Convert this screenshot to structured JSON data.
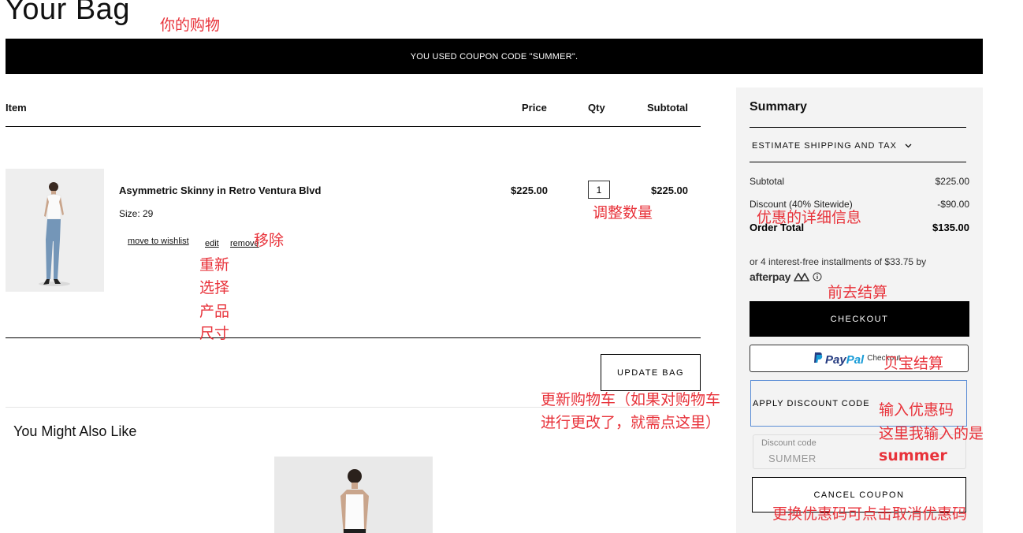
{
  "page": {
    "title": "Your Bag"
  },
  "banner": {
    "text": "YOU USED COUPON CODE \"SUMMER\"."
  },
  "table": {
    "headers": {
      "item": "Item",
      "price": "Price",
      "qty": "Qty",
      "subtotal": "Subtotal"
    }
  },
  "item": {
    "name": "Asymmetric Skinny in Retro Ventura Blvd",
    "size": "Size: 29",
    "price": "$225.00",
    "qty": "1",
    "subtotal": "$225.00",
    "links": {
      "wishlist": "move to wishlist",
      "edit": "edit",
      "remove": "remove"
    }
  },
  "actions": {
    "update_bag": "UPDATE BAG"
  },
  "recommendations": {
    "title": "You Might Also Like"
  },
  "summary": {
    "title": "Summary",
    "estimate_shipping": "ESTIMATE SHIPPING AND TAX",
    "subtotal_label": "Subtotal",
    "subtotal_value": "$225.00",
    "discount_label": "Discount (40% Sitewide)",
    "discount_value": "-$90.00",
    "order_total_label": "Order Total",
    "order_total_value": "$135.00",
    "afterpay_text": "or 4 interest-free installments of $33.75 by",
    "afterpay_logo": "afterpay",
    "checkout": "CHECKOUT",
    "paypal_pay": "Pay",
    "paypal_pal": "Pal",
    "paypal_checkout": "Checkout",
    "apply_discount": "APPLY DISCOUNT CODE",
    "discount_field_label": "Discount code",
    "discount_field_value": "SUMMER",
    "cancel_coupon": "CANCEL COUPON"
  },
  "annotations": {
    "title_note": "你的购物",
    "qty_note": "调整数量",
    "remove_note": "移除",
    "edit_note": [
      "重新",
      "选择",
      "产品",
      "尺寸"
    ],
    "update_note": [
      "更新购物车（如果对购物车",
      "进行更改了，就需点这里）"
    ],
    "discount_detail_note": "优惠的详细信息",
    "checkout_note": "前去结算",
    "paypal_note": "贝宝结算",
    "coupon_note": [
      "输入优惠码",
      "这里我输入的是"
    ],
    "coupon_value_note": "summer",
    "cancel_note": "更换优惠码可点击取消优惠码"
  },
  "colors": {
    "annotation": "#e8323a",
    "banner_bg": "#000000",
    "summary_bg": "#f3f3f3",
    "paypal_dark": "#253b80",
    "paypal_light": "#179bd7"
  }
}
